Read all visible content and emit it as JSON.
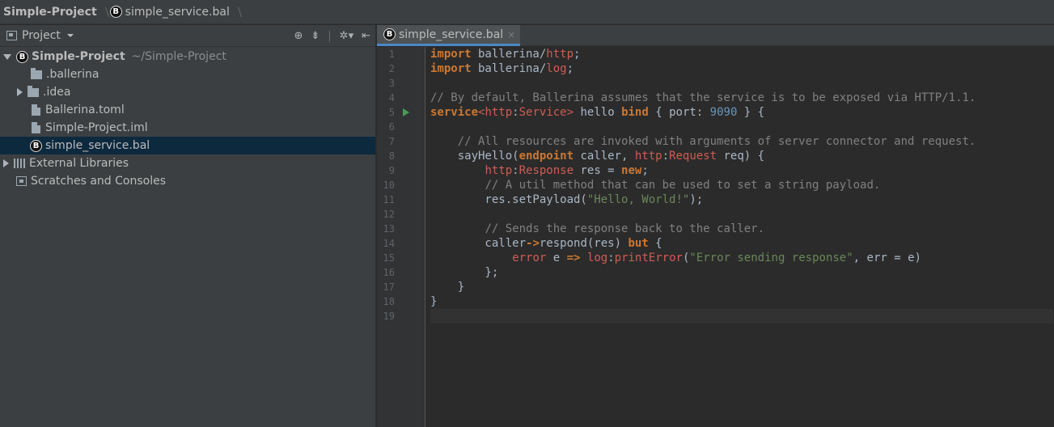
{
  "breadcrumb": {
    "project": "Simple-Project",
    "file": "simple_service.bal"
  },
  "project_panel": {
    "title": "Project",
    "toolbar_icons": [
      "target-icon",
      "collapse-icon",
      "gear-icon",
      "hide-icon"
    ],
    "tree": [
      {
        "label": "Simple-Project",
        "path": "~/Simple-Project",
        "type": "ballerina-root",
        "expanded": true
      },
      {
        "label": ".ballerina",
        "type": "folder"
      },
      {
        "label": ".idea",
        "type": "folder",
        "expandable": true
      },
      {
        "label": "Ballerina.toml",
        "type": "file"
      },
      {
        "label": "Simple-Project.iml",
        "type": "file"
      },
      {
        "label": "simple_service.bal",
        "type": "ballerina-file",
        "selected": true
      },
      {
        "label": "External Libraries",
        "type": "libraries",
        "expandable": true
      },
      {
        "label": "Scratches and Consoles",
        "type": "scratches"
      }
    ]
  },
  "editor": {
    "tab": {
      "label": "simple_service.bal",
      "close": "×"
    },
    "line_numbers": [
      "1",
      "2",
      "3",
      "4",
      "5",
      "6",
      "7",
      "8",
      "9",
      "10",
      "11",
      "12",
      "13",
      "14",
      "15",
      "16",
      "17",
      "18",
      "19"
    ],
    "code_lines": [
      "import ballerina/http;",
      "import ballerina/log;",
      "",
      "// By default, Ballerina assumes that the service is to be exposed via HTTP/1.1.",
      "service<http:Service> hello bind { port: 9090 } {",
      "",
      "    // All resources are invoked with arguments of server connector and request.",
      "    sayHello(endpoint caller, http:Request req) {",
      "        http:Response res = new;",
      "        // A util method that can be used to set a string payload.",
      "        res.setPayload(\"Hello, World!\");",
      "",
      "        // Sends the response back to the caller.",
      "        caller->respond(res) but {",
      "            error e => log:printError(\"Error sending response\", err = e)",
      "        };",
      "    }",
      "}",
      ""
    ],
    "run_marker_line": 5,
    "colors": {
      "keyword": "#cc7832",
      "type": "#cf5d54",
      "comment": "#808080",
      "string": "#6a8759",
      "number": "#6897bb",
      "default": "#a9b7c6"
    }
  }
}
